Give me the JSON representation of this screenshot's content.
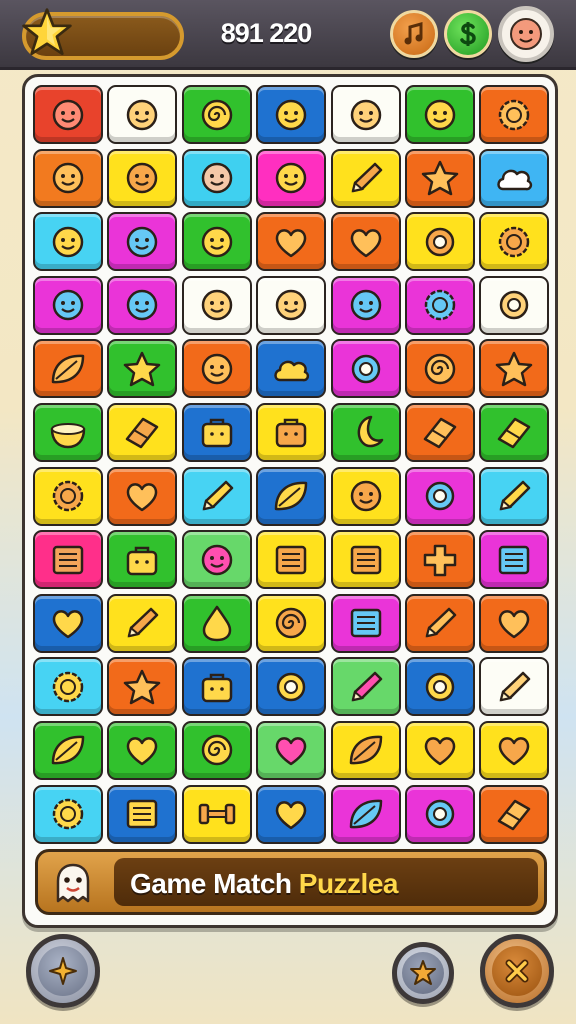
{
  "hud": {
    "score": "891 220",
    "star_meter_fill": 0,
    "buttons": [
      "music-button",
      "coin-button",
      "profile-avatar-button"
    ]
  },
  "board": {
    "columns": 7,
    "rows": 12,
    "tiles": [
      {
        "color": "#e8432c",
        "icon": "face"
      },
      {
        "color": "#fdfdf6",
        "icon": "face"
      },
      {
        "color": "#31c12d",
        "icon": "swirl"
      },
      {
        "color": "#1f72d0",
        "icon": "face"
      },
      {
        "color": "#fdfdf6",
        "icon": "face"
      },
      {
        "color": "#31c12d",
        "icon": "face"
      },
      {
        "color": "#f26a1a",
        "icon": "flower"
      },
      {
        "color": "#f27a1f",
        "icon": "face"
      },
      {
        "color": "#ffe11d",
        "icon": "face"
      },
      {
        "color": "#3fd0f0",
        "icon": "face"
      },
      {
        "color": "#ff2fc0",
        "icon": "face"
      },
      {
        "color": "#ffe11d",
        "icon": "pencil"
      },
      {
        "color": "#f26a1a",
        "icon": "star"
      },
      {
        "color": "#3fb5f3",
        "icon": "cloud"
      },
      {
        "color": "#47d3f3",
        "icon": "face"
      },
      {
        "color": "#ea34d8",
        "icon": "face"
      },
      {
        "color": "#31c12d",
        "icon": "face"
      },
      {
        "color": "#f26a1a",
        "icon": "heart"
      },
      {
        "color": "#f26a1a",
        "icon": "heart"
      },
      {
        "color": "#ffe11d",
        "icon": "ring"
      },
      {
        "color": "#ffe11d",
        "icon": "flower"
      },
      {
        "color": "#ea34d8",
        "icon": "face"
      },
      {
        "color": "#ea34d8",
        "icon": "face"
      },
      {
        "color": "#fdfdf6",
        "icon": "face"
      },
      {
        "color": "#fdfdf6",
        "icon": "face"
      },
      {
        "color": "#ea34d8",
        "icon": "face"
      },
      {
        "color": "#ea34d8",
        "icon": "flower"
      },
      {
        "color": "#fdfdf6",
        "icon": "ring"
      },
      {
        "color": "#f26a1a",
        "icon": "leaf"
      },
      {
        "color": "#31c12d",
        "icon": "star"
      },
      {
        "color": "#f26a1a",
        "icon": "face"
      },
      {
        "color": "#1f72d0",
        "icon": "cloud"
      },
      {
        "color": "#ea34d8",
        "icon": "ring"
      },
      {
        "color": "#f26a1a",
        "icon": "swirl"
      },
      {
        "color": "#f26a1a",
        "icon": "star"
      },
      {
        "color": "#31c12d",
        "icon": "bowl"
      },
      {
        "color": "#ffe11d",
        "icon": "eraser"
      },
      {
        "color": "#1f72d0",
        "icon": "bag"
      },
      {
        "color": "#ffe11d",
        "icon": "bag"
      },
      {
        "color": "#31c12d",
        "icon": "moon"
      },
      {
        "color": "#f26a1a",
        "icon": "eraser"
      },
      {
        "color": "#31c12d",
        "icon": "eraser"
      },
      {
        "color": "#ffe11d",
        "icon": "flower"
      },
      {
        "color": "#f26a1a",
        "icon": "heart"
      },
      {
        "color": "#47d3f3",
        "icon": "pencil"
      },
      {
        "color": "#1f72d0",
        "icon": "leaf"
      },
      {
        "color": "#ffe11d",
        "icon": "face"
      },
      {
        "color": "#ea34d8",
        "icon": "ring"
      },
      {
        "color": "#47d3f3",
        "icon": "pencil"
      },
      {
        "color": "#ff2f8a",
        "icon": "box"
      },
      {
        "color": "#31c12d",
        "icon": "bag"
      },
      {
        "color": "#67d86a",
        "icon": "face"
      },
      {
        "color": "#ffe11d",
        "icon": "box"
      },
      {
        "color": "#ffe11d",
        "icon": "box"
      },
      {
        "color": "#f26a1a",
        "icon": "cross"
      },
      {
        "color": "#ea34d8",
        "icon": "box"
      },
      {
        "color": "#1f72d0",
        "icon": "heart"
      },
      {
        "color": "#ffe11d",
        "icon": "pencil"
      },
      {
        "color": "#31c12d",
        "icon": "drop"
      },
      {
        "color": "#ffe11d",
        "icon": "swirl"
      },
      {
        "color": "#ea34d8",
        "icon": "box"
      },
      {
        "color": "#f26a1a",
        "icon": "pencil"
      },
      {
        "color": "#f26a1a",
        "icon": "heart"
      },
      {
        "color": "#47d3f3",
        "icon": "flower"
      },
      {
        "color": "#f26a1a",
        "icon": "star"
      },
      {
        "color": "#1f72d0",
        "icon": "bag"
      },
      {
        "color": "#1f72d0",
        "icon": "ring"
      },
      {
        "color": "#67d86a",
        "icon": "pencil"
      },
      {
        "color": "#1f72d0",
        "icon": "ring"
      },
      {
        "color": "#fdfdf6",
        "icon": "pencil"
      },
      {
        "color": "#31c12d",
        "icon": "leaf"
      },
      {
        "color": "#31c12d",
        "icon": "heart"
      },
      {
        "color": "#31c12d",
        "icon": "swirl"
      },
      {
        "color": "#67d86a",
        "icon": "heart"
      },
      {
        "color": "#ffe11d",
        "icon": "leaf"
      },
      {
        "color": "#ffe11d",
        "icon": "heart"
      },
      {
        "color": "#ffe11d",
        "icon": "heart"
      },
      {
        "color": "#47d3f3",
        "icon": "flower"
      },
      {
        "color": "#1f72d0",
        "icon": "box"
      },
      {
        "color": "#ffe11d",
        "icon": "dumbbell"
      },
      {
        "color": "#1f72d0",
        "icon": "heart"
      },
      {
        "color": "#ea34d8",
        "icon": "leaf"
      },
      {
        "color": "#ea34d8",
        "icon": "ring"
      },
      {
        "color": "#f26a1a",
        "icon": "eraser"
      }
    ]
  },
  "banner": {
    "title_main": "Game Match ",
    "title_accent": "Puzzlea"
  },
  "footer": {
    "buttons": [
      "hint-button",
      "booster-button",
      "close-button"
    ]
  },
  "colors": {
    "topbar": "#4a4650",
    "banner_gold": "#d1923a",
    "banner_dark": "#5c340d",
    "title_accent": "#ffd84a"
  }
}
